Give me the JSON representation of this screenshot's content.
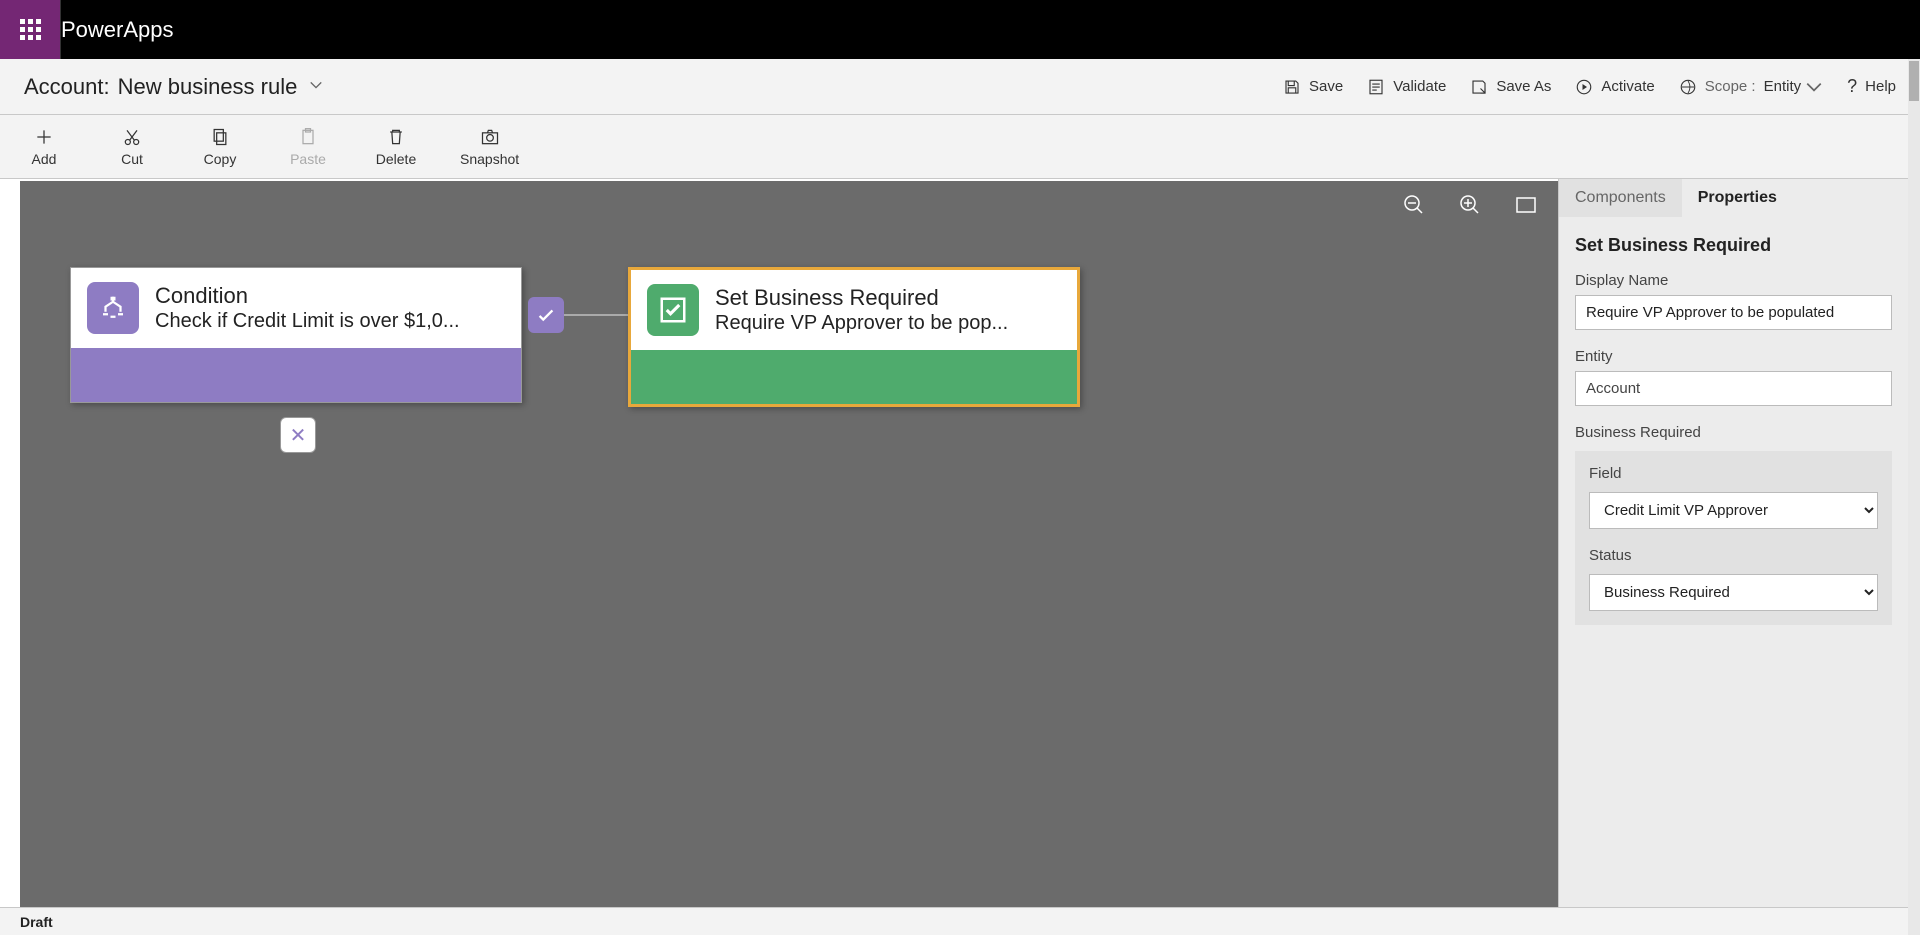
{
  "app": {
    "title": "PowerApps"
  },
  "page": {
    "prefix": "Account:",
    "name": "New business rule"
  },
  "headerActions": {
    "save": "Save",
    "validate": "Validate",
    "saveAs": "Save As",
    "activate": "Activate",
    "scopeLabel": "Scope :",
    "scopeValue": "Entity",
    "help": "Help"
  },
  "toolbar": {
    "add": "Add",
    "cut": "Cut",
    "copy": "Copy",
    "paste": "Paste",
    "delete": "Delete",
    "snapshot": "Snapshot"
  },
  "canvas": {
    "conditionNode": {
      "title": "Condition",
      "subtitle": "Check if Credit Limit is over $1,0..."
    },
    "actionNode": {
      "title": "Set Business Required",
      "subtitle": "Require VP Approver to be pop..."
    }
  },
  "panel": {
    "tabs": {
      "components": "Components",
      "properties": "Properties"
    },
    "title": "Set Business Required",
    "displayNameLabel": "Display Name",
    "displayNameValue": "Require VP Approver to be populated",
    "entityLabel": "Entity",
    "entityValue": "Account",
    "brSection": "Business Required",
    "fieldLabel": "Field",
    "fieldValue": "Credit Limit VP Approver",
    "statusLabel": "Status",
    "statusValue": "Business Required"
  },
  "status": {
    "text": "Draft"
  }
}
